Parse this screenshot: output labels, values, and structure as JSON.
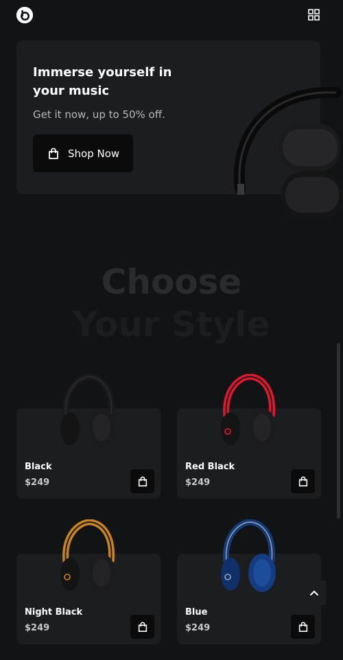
{
  "header": {
    "logo_icon": "beats-logo-icon",
    "menu_icon": "grid-icon"
  },
  "hero": {
    "title": "Immerse yourself in your music",
    "subtitle": "Get it now, up to 50% off.",
    "cta_label": "Shop Now",
    "cta_icon": "shopping-bag-icon"
  },
  "section": {
    "title_line1": "Choose",
    "title_line2": "Your Style"
  },
  "products": [
    {
      "name": "Black",
      "price": "$249",
      "color": "#1a1a1c",
      "accent": "#2a2a2d"
    },
    {
      "name": "Red Black",
      "price": "$249",
      "color": "#1a1a1c",
      "accent": "#e0182d"
    },
    {
      "name": "Night Black",
      "price": "$249",
      "color": "#1a1a1c",
      "accent": "#c98420"
    },
    {
      "name": "Blue",
      "price": "$249",
      "color": "#143a78",
      "accent": "#1c4c9a"
    }
  ],
  "controls": {
    "scroll_top_icon": "chevron-up-icon"
  },
  "colors": {
    "background": "#121314",
    "card": "#1c1d1f",
    "button": "#0b0b0c"
  }
}
